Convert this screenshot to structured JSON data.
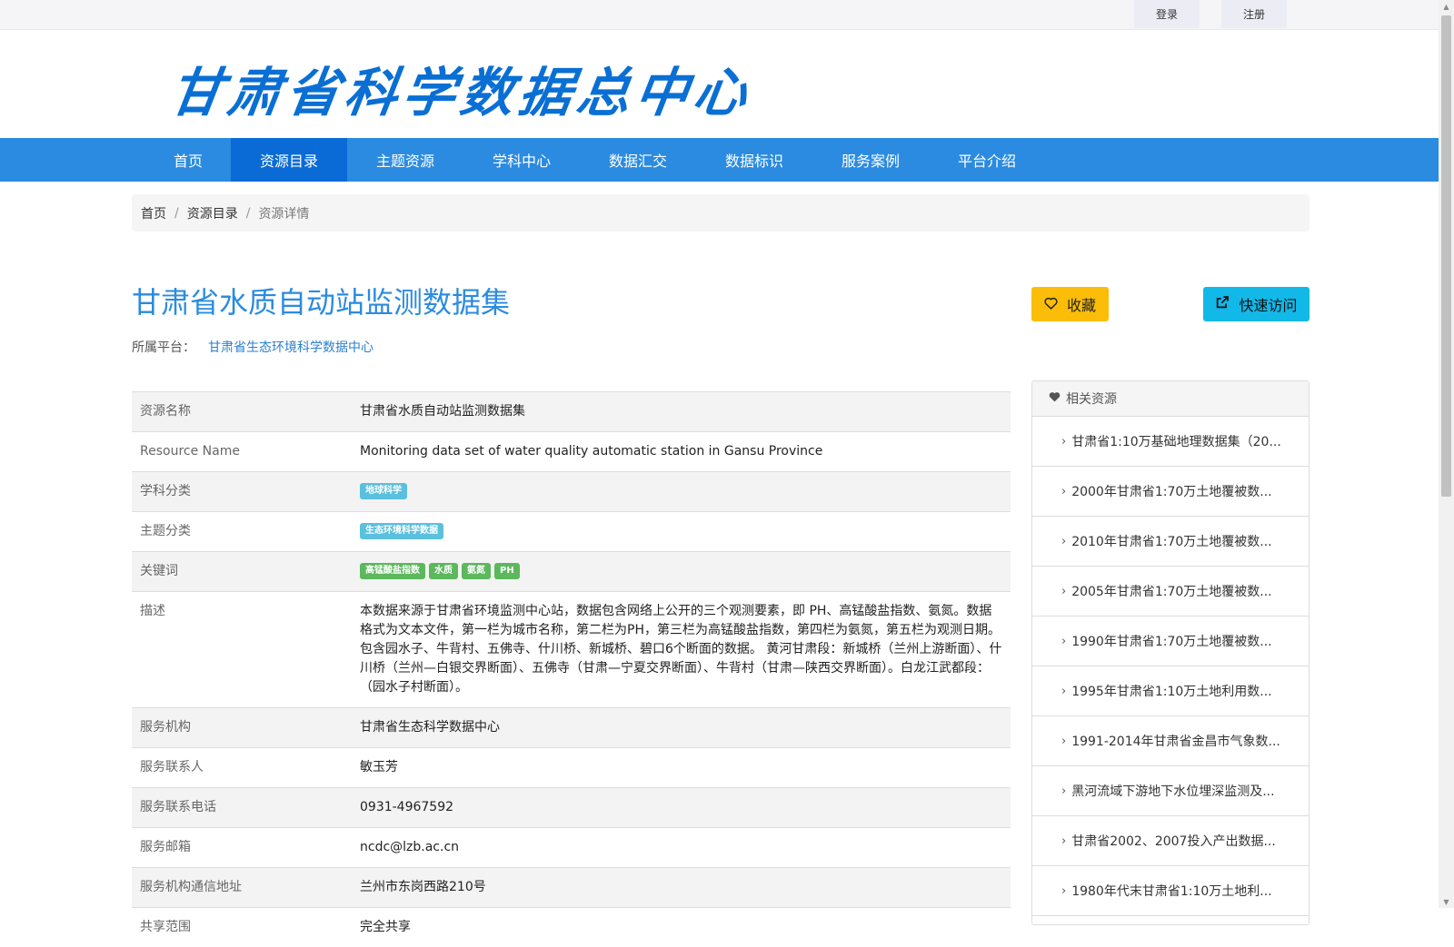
{
  "topbar": {
    "login": "登录",
    "register": "注册"
  },
  "header": {
    "logo_text": "甘肃省科学数据总中心"
  },
  "nav": [
    {
      "label": "首页",
      "active": false
    },
    {
      "label": "资源目录",
      "active": true
    },
    {
      "label": "主题资源",
      "active": false
    },
    {
      "label": "学科中心",
      "active": false
    },
    {
      "label": "数据汇交",
      "active": false
    },
    {
      "label": "数据标识",
      "active": false
    },
    {
      "label": "服务案例",
      "active": false
    },
    {
      "label": "平台介绍",
      "active": false
    }
  ],
  "breadcrumb": {
    "home": "首页",
    "catalog": "资源目录",
    "current": "资源详情"
  },
  "resource": {
    "title": "甘肃省水质自动站监测数据集",
    "platform_label": "所属平台：",
    "platform": "甘肃省生态环境科学数据中心",
    "favorite_label": "收藏",
    "quick_access_label": "快速访问"
  },
  "info": {
    "name_k": "资源名称",
    "name_v": "甘肃省水质自动站监测数据集",
    "ename_k": "Resource Name",
    "ename_v": "Monitoring data set of water quality automatic station in Gansu Province",
    "subject_k": "学科分类",
    "subject_tag": "地球科学",
    "theme_k": "主题分类",
    "theme_tag": "生态环境科学数据",
    "keywords_k": "关键词",
    "keywords": [
      "高锰酸盐指数",
      "水质",
      "氨氮",
      "PH"
    ],
    "desc_k": "描述",
    "desc_v": "本数据来源于甘肃省环境监测中心站，数据包含网络上公开的三个观测要素，即 PH、高锰酸盐指数、氨氮。数据格式为文本文件，第一栏为城市名称，第二栏为PH，第三栏为高锰酸盐指数，第四栏为氨氮，第五栏为观测日期。 包含园水子、牛背村、五佛寺、什川桥、新城桥、碧口6个断面的数据。 黄河甘肃段：新城桥（兰州上游断面）、什川桥（兰州—白银交界断面）、五佛寺（甘肃—宁夏交界断面）、牛背村（甘肃—陕西交界断面）。白龙江武都段：（园水子村断面）。",
    "org_k": "服务机构",
    "org_v": "甘肃省生态科学数据中心",
    "contact_k": "服务联系人",
    "contact_v": "敏玉芳",
    "phone_k": "服务联系电话",
    "phone_v": "0931-4967592",
    "email_k": "服务邮箱",
    "email_v": "ncdc@lzb.ac.cn",
    "addr_k": "服务机构通信地址",
    "addr_v": "兰州市东岗西路210号",
    "share_k": "共享范围",
    "share_v": "完全共享"
  },
  "related": {
    "title": "相关资源",
    "items": [
      "甘肃省1:10万基础地理数据集（20...",
      "2000年甘肃省1:70万土地覆被数...",
      "2010年甘肃省1:70万土地覆被数...",
      "2005年甘肃省1:70万土地覆被数...",
      "1990年甘肃省1:70万土地覆被数...",
      "1995年甘肃省1:10万土地利用数...",
      "1991-2014年甘肃省金昌市气象数...",
      "黑河流域下游地下水位埋深监测及...",
      "甘肃省2002、2007投入产出数据...",
      "1980年代末甘肃省1:10万土地利..."
    ]
  },
  "colors": {
    "nav": "#2b8be0",
    "nav_active": "#0a6bd6",
    "title": "#2b8be0",
    "favorite": "#fbbd08",
    "quick": "#11b8e8"
  }
}
